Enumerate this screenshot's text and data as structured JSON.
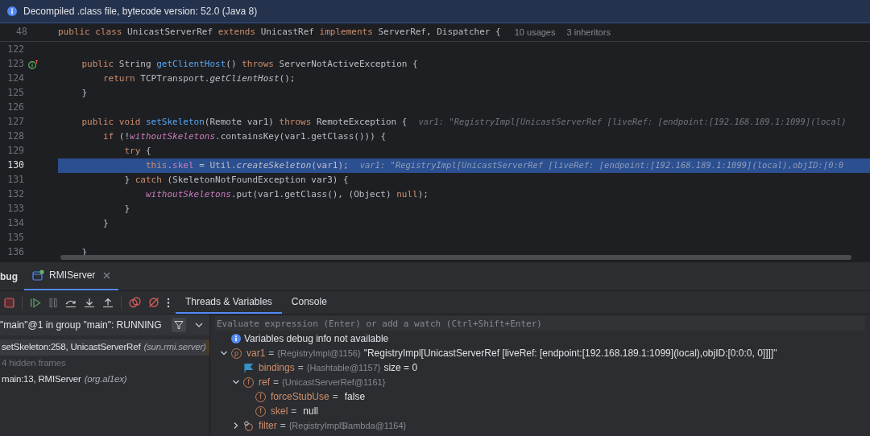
{
  "banner": {
    "text": "Decompiled .class file, bytecode version: 52.0 (Java 8)"
  },
  "editor": {
    "sticky_line": {
      "num": "48",
      "tokens": [
        {
          "kind": "keyword",
          "text": "public class "
        },
        {
          "kind": "plain",
          "text": "UnicastServerRef "
        },
        {
          "kind": "keyword",
          "text": "extends "
        },
        {
          "kind": "plain",
          "text": "UnicastRef "
        },
        {
          "kind": "keyword",
          "text": "implements "
        },
        {
          "kind": "plain",
          "text": "ServerRef, Dispatcher {"
        }
      ],
      "meta": [
        "10 usages",
        "3 inheritors"
      ]
    },
    "lines": [
      {
        "num": "122",
        "selected": false
      },
      {
        "num": "123",
        "selected": false,
        "gutter": {
          "kind": "implements"
        },
        "tokens": [
          {
            "kind": "keyword",
            "text": "    public "
          },
          {
            "kind": "plain",
            "text": "String "
          },
          {
            "kind": "method",
            "text": "getClientHost"
          },
          {
            "kind": "plain",
            "text": "() "
          },
          {
            "kind": "keyword",
            "text": "throws "
          },
          {
            "kind": "plain",
            "text": "ServerNotActiveException {"
          }
        ]
      },
      {
        "num": "124",
        "selected": false,
        "tokens": [
          {
            "kind": "keyword",
            "text": "        return "
          },
          {
            "kind": "plain",
            "text": "TCPTransport."
          },
          {
            "kind": "italic",
            "text": "getClientHost"
          },
          {
            "kind": "plain",
            "text": "();"
          }
        ]
      },
      {
        "num": "125",
        "selected": false,
        "tokens": [
          {
            "kind": "plain",
            "text": "    }"
          }
        ]
      },
      {
        "num": "126",
        "selected": false
      },
      {
        "num": "127",
        "selected": false,
        "tokens": [
          {
            "kind": "keyword",
            "text": "    public void "
          },
          {
            "kind": "method",
            "text": "setSkeleton"
          },
          {
            "kind": "plain",
            "text": "(Remote var1) "
          },
          {
            "kind": "keyword",
            "text": "throws "
          },
          {
            "kind": "plain",
            "text": "RemoteException {"
          }
        ],
        "hint": "var1: \"RegistryImpl[UnicastServerRef [liveRef: [endpoint:[192.168.189.1:1099](local)"
      },
      {
        "num": "128",
        "selected": false,
        "tokens": [
          {
            "kind": "keyword",
            "text": "        if "
          },
          {
            "kind": "plain",
            "text": "(!"
          },
          {
            "kind": "static",
            "text": "withoutSkeletons"
          },
          {
            "kind": "plain",
            "text": ".containsKey(var1.getClass())) {"
          }
        ]
      },
      {
        "num": "129",
        "selected": false,
        "tokens": [
          {
            "kind": "keyword",
            "text": "            try "
          },
          {
            "kind": "plain",
            "text": "{"
          }
        ]
      },
      {
        "num": "130",
        "selected": true,
        "tokens": [
          {
            "kind": "keyword",
            "text": "                this"
          },
          {
            "kind": "plain",
            "text": "."
          },
          {
            "kind": "field",
            "text": "skel"
          },
          {
            "kind": "plain",
            "text": " = Util."
          },
          {
            "kind": "italic",
            "text": "createSkeleton"
          },
          {
            "kind": "plain",
            "text": "(var1);"
          }
        ],
        "hint": "var1: \"RegistryImpl[UnicastServerRef [liveRef: [endpoint:[192.168.189.1:1099](local),objID:[0:0"
      },
      {
        "num": "131",
        "selected": false,
        "tokens": [
          {
            "kind": "plain",
            "text": "            } "
          },
          {
            "kind": "keyword",
            "text": "catch "
          },
          {
            "kind": "plain",
            "text": "(SkeletonNotFoundException var3) {"
          }
        ]
      },
      {
        "num": "132",
        "selected": false,
        "tokens": [
          {
            "kind": "static",
            "text": "                withoutSkeletons"
          },
          {
            "kind": "plain",
            "text": ".put(var1.getClass(), (Object) "
          },
          {
            "kind": "keyword",
            "text": "null"
          },
          {
            "kind": "plain",
            "text": ");"
          }
        ]
      },
      {
        "num": "133",
        "selected": false,
        "tokens": [
          {
            "kind": "plain",
            "text": "            }"
          }
        ]
      },
      {
        "num": "134",
        "selected": false,
        "tokens": [
          {
            "kind": "plain",
            "text": "        }"
          }
        ]
      },
      {
        "num": "135",
        "selected": false
      },
      {
        "num": "136",
        "selected": false,
        "tokens": [
          {
            "kind": "plain",
            "text": "    }"
          }
        ]
      }
    ]
  },
  "debug_panel": {
    "title": "bug",
    "session_tab": {
      "label": "RMIServer",
      "selected": true
    },
    "tabs": [
      {
        "label": "Threads & Variables",
        "selected": true
      },
      {
        "label": "Console",
        "selected": false
      }
    ],
    "thread_selector": {
      "value": "\"main\"@1 in group \"main\": RUNNING"
    },
    "frames": [
      {
        "kind": "frame",
        "selected": true,
        "location": "setSkeleton:258, UnicastServerRef",
        "package": "(sun.rmi.server)"
      },
      {
        "kind": "hidden",
        "selected": false,
        "location": "4 hidden frames"
      },
      {
        "kind": "frame",
        "selected": false,
        "location": "main:13, RMIServer",
        "package": "(org.al1ex)"
      }
    ],
    "evaluate": {
      "placeholder": "Evaluate expression (Enter) or add a watch (Ctrl+Shift+Enter)"
    },
    "notice": "Variables debug info not available",
    "variables": [
      {
        "kind": "param",
        "badge": "p",
        "name": "var1",
        "op": "=",
        "type": "{RegistryImpl@1156}",
        "value": "\"RegistryImpl[UnicastServerRef [liveRef: [endpoint:[192.168.189.1:1099](local),objID:[0:0:0, 0]]]]\"",
        "expanded": true,
        "children": [
          {
            "kind": "map",
            "name": "bindings",
            "op": "=",
            "type": "{Hashtable@1157}",
            "value": "size = 0"
          },
          {
            "kind": "field",
            "badge": "f",
            "name": "ref",
            "op": "=",
            "type": "{UnicastServerRef@1161}",
            "expanded": true,
            "children": [
              {
                "kind": "field",
                "badge": "f",
                "name": "forceStubUse",
                "op": "=",
                "value": "false"
              },
              {
                "kind": "field",
                "badge": "f",
                "name": "skel",
                "op": "=",
                "value": "null"
              }
            ]
          },
          {
            "kind": "lambda",
            "name": "filter",
            "op": "=",
            "type": "{RegistryImpl$lambda@1164}",
            "expanded": false
          }
        ]
      }
    ]
  }
}
